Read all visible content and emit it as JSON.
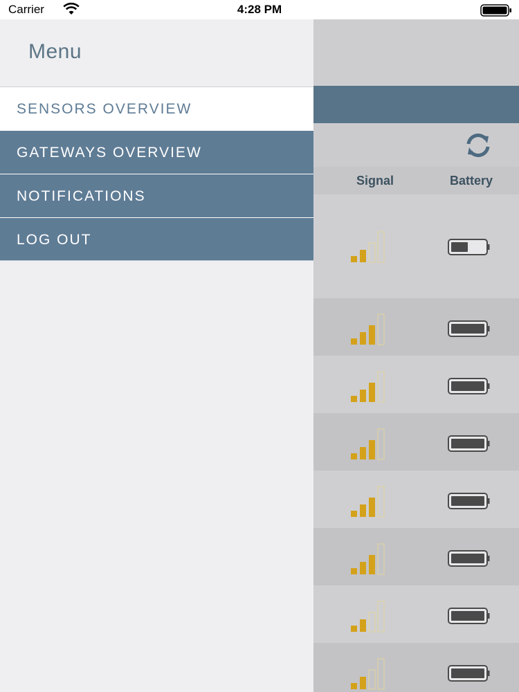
{
  "status_bar": {
    "carrier": "Carrier",
    "time": "4:28 PM"
  },
  "menu": {
    "title": "Menu",
    "items": [
      {
        "label": "SENSORS OVERVIEW",
        "active": true
      },
      {
        "label": "GATEWAYS OVERVIEW",
        "active": false
      },
      {
        "label": "NOTIFICATIONS",
        "active": false
      },
      {
        "label": "LOG OUT",
        "active": false
      }
    ]
  },
  "table": {
    "columns": [
      "Signal",
      "Battery"
    ],
    "rows": [
      {
        "signal_bars": 2,
        "battery_level": 0.5
      },
      {
        "signal_bars": 3,
        "battery_level": 1.0
      },
      {
        "signal_bars": 3,
        "battery_level": 1.0
      },
      {
        "signal_bars": 3,
        "battery_level": 1.0
      },
      {
        "signal_bars": 3,
        "battery_level": 1.0
      },
      {
        "signal_bars": 3,
        "battery_level": 1.0
      },
      {
        "signal_bars": 2,
        "battery_level": 1.0
      },
      {
        "signal_bars": 2,
        "battery_level": 1.0
      }
    ]
  },
  "icons": {
    "refresh": "refresh-icon",
    "wifi": "wifi-icon",
    "battery": "battery-icon",
    "signal": "signal-strength-icon"
  },
  "colors": {
    "menu_item_bg": "#5f7c95",
    "menu_active_text": "#5f7c95",
    "header_bar": "#587489",
    "signal_active": "#d4a21a",
    "signal_inactive": "#e3d49a",
    "battery_fill": "#4a4a4a"
  }
}
